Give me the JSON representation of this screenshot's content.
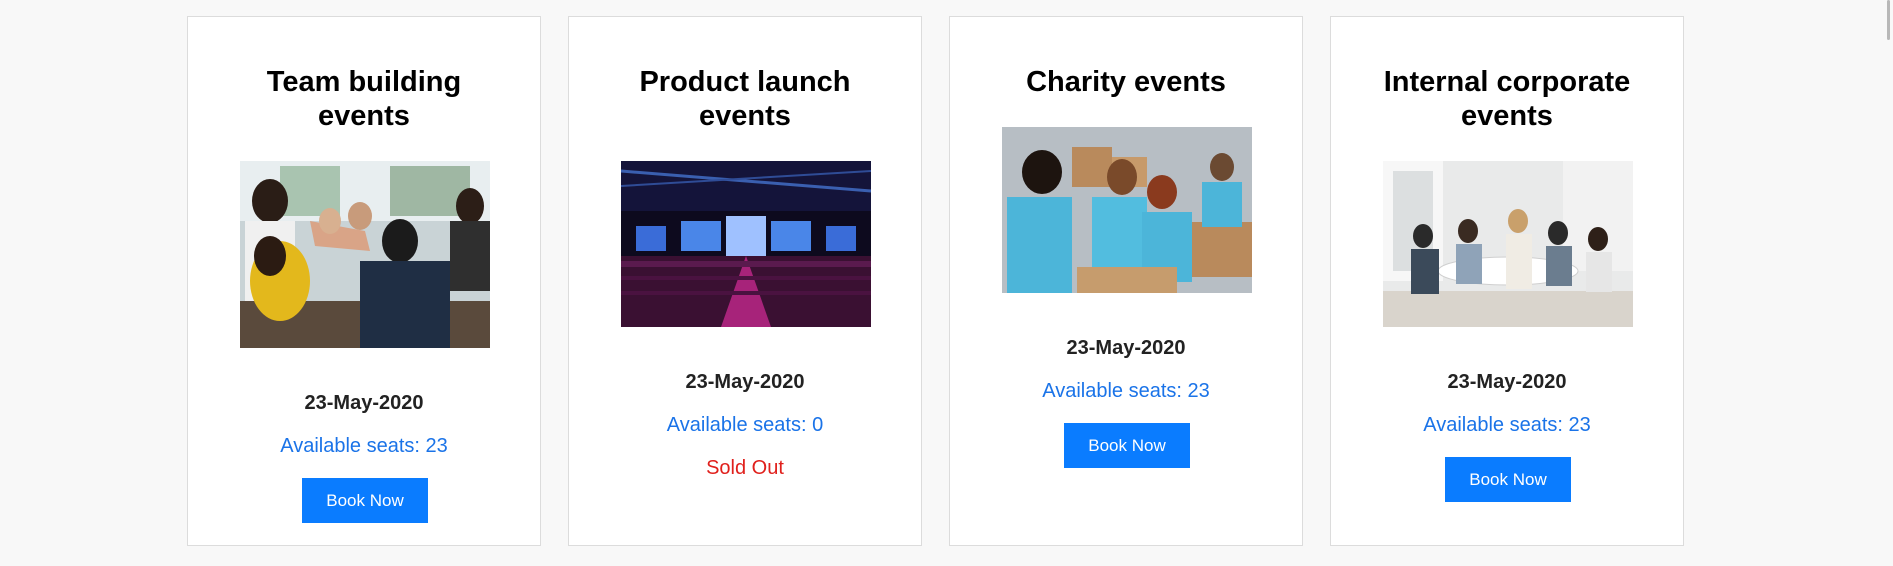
{
  "cards": [
    {
      "title": "Team building events",
      "image": "team-building-photo",
      "date": "23-May-2020",
      "seats": "Available seats: 23",
      "button": "Book Now"
    },
    {
      "title": "Product launch events",
      "image": "product-launch-photo",
      "date": "23-May-2020",
      "seats": "Available seats: 0",
      "status": "Sold Out"
    },
    {
      "title": "Charity events",
      "image": "charity-photo",
      "date": "23-May-2020",
      "seats": "Available seats: 23",
      "button": "Book Now"
    },
    {
      "title": "Internal corporate events",
      "image": "corporate-meeting-photo",
      "date": "23-May-2020",
      "seats": "Available seats: 23",
      "button": "Book Now"
    }
  ],
  "colors": {
    "accent": "#0a7cff",
    "seats_text": "#1a73e8",
    "sold_out": "#e0201c"
  }
}
